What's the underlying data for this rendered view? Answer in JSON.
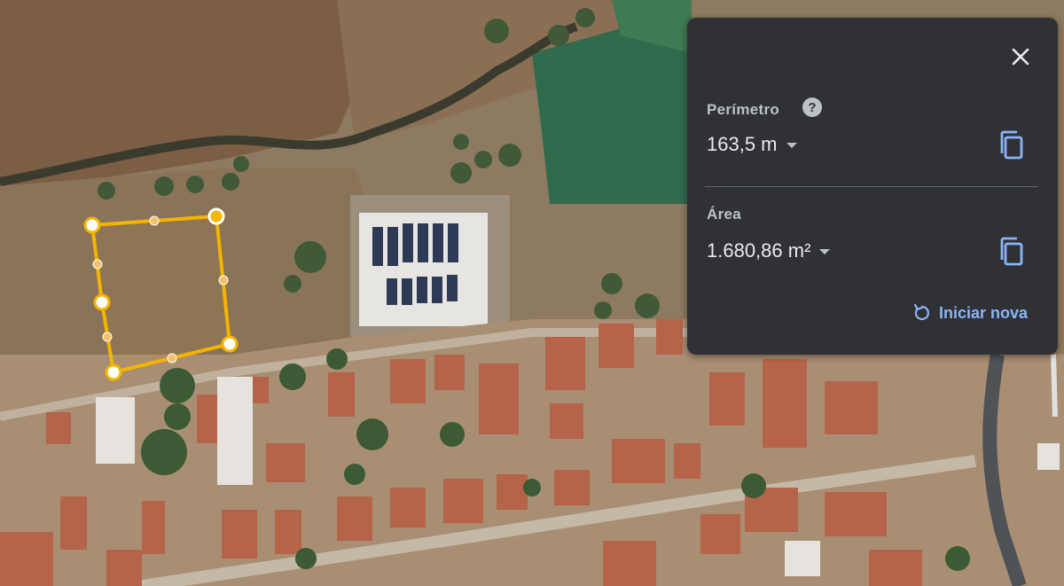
{
  "measure_panel": {
    "perimeter_label": "Perímetro",
    "perimeter_value": "163,5 m",
    "area_label": "Área",
    "area_value": "1.680,86 m²",
    "reset_label": "Iniciar nova",
    "help_glyph": "?"
  },
  "icons": {
    "close": "close-icon",
    "help": "help-icon",
    "copy": "copy-icon",
    "reset": "restart-icon",
    "dropdown": "caret-down-icon"
  },
  "colors": {
    "panel_bg": "#303134",
    "text_primary": "#e8eaed",
    "text_secondary": "#bdc1c6",
    "accent_blue": "#8ab4f8",
    "polygon_stroke": "#f4b400"
  }
}
